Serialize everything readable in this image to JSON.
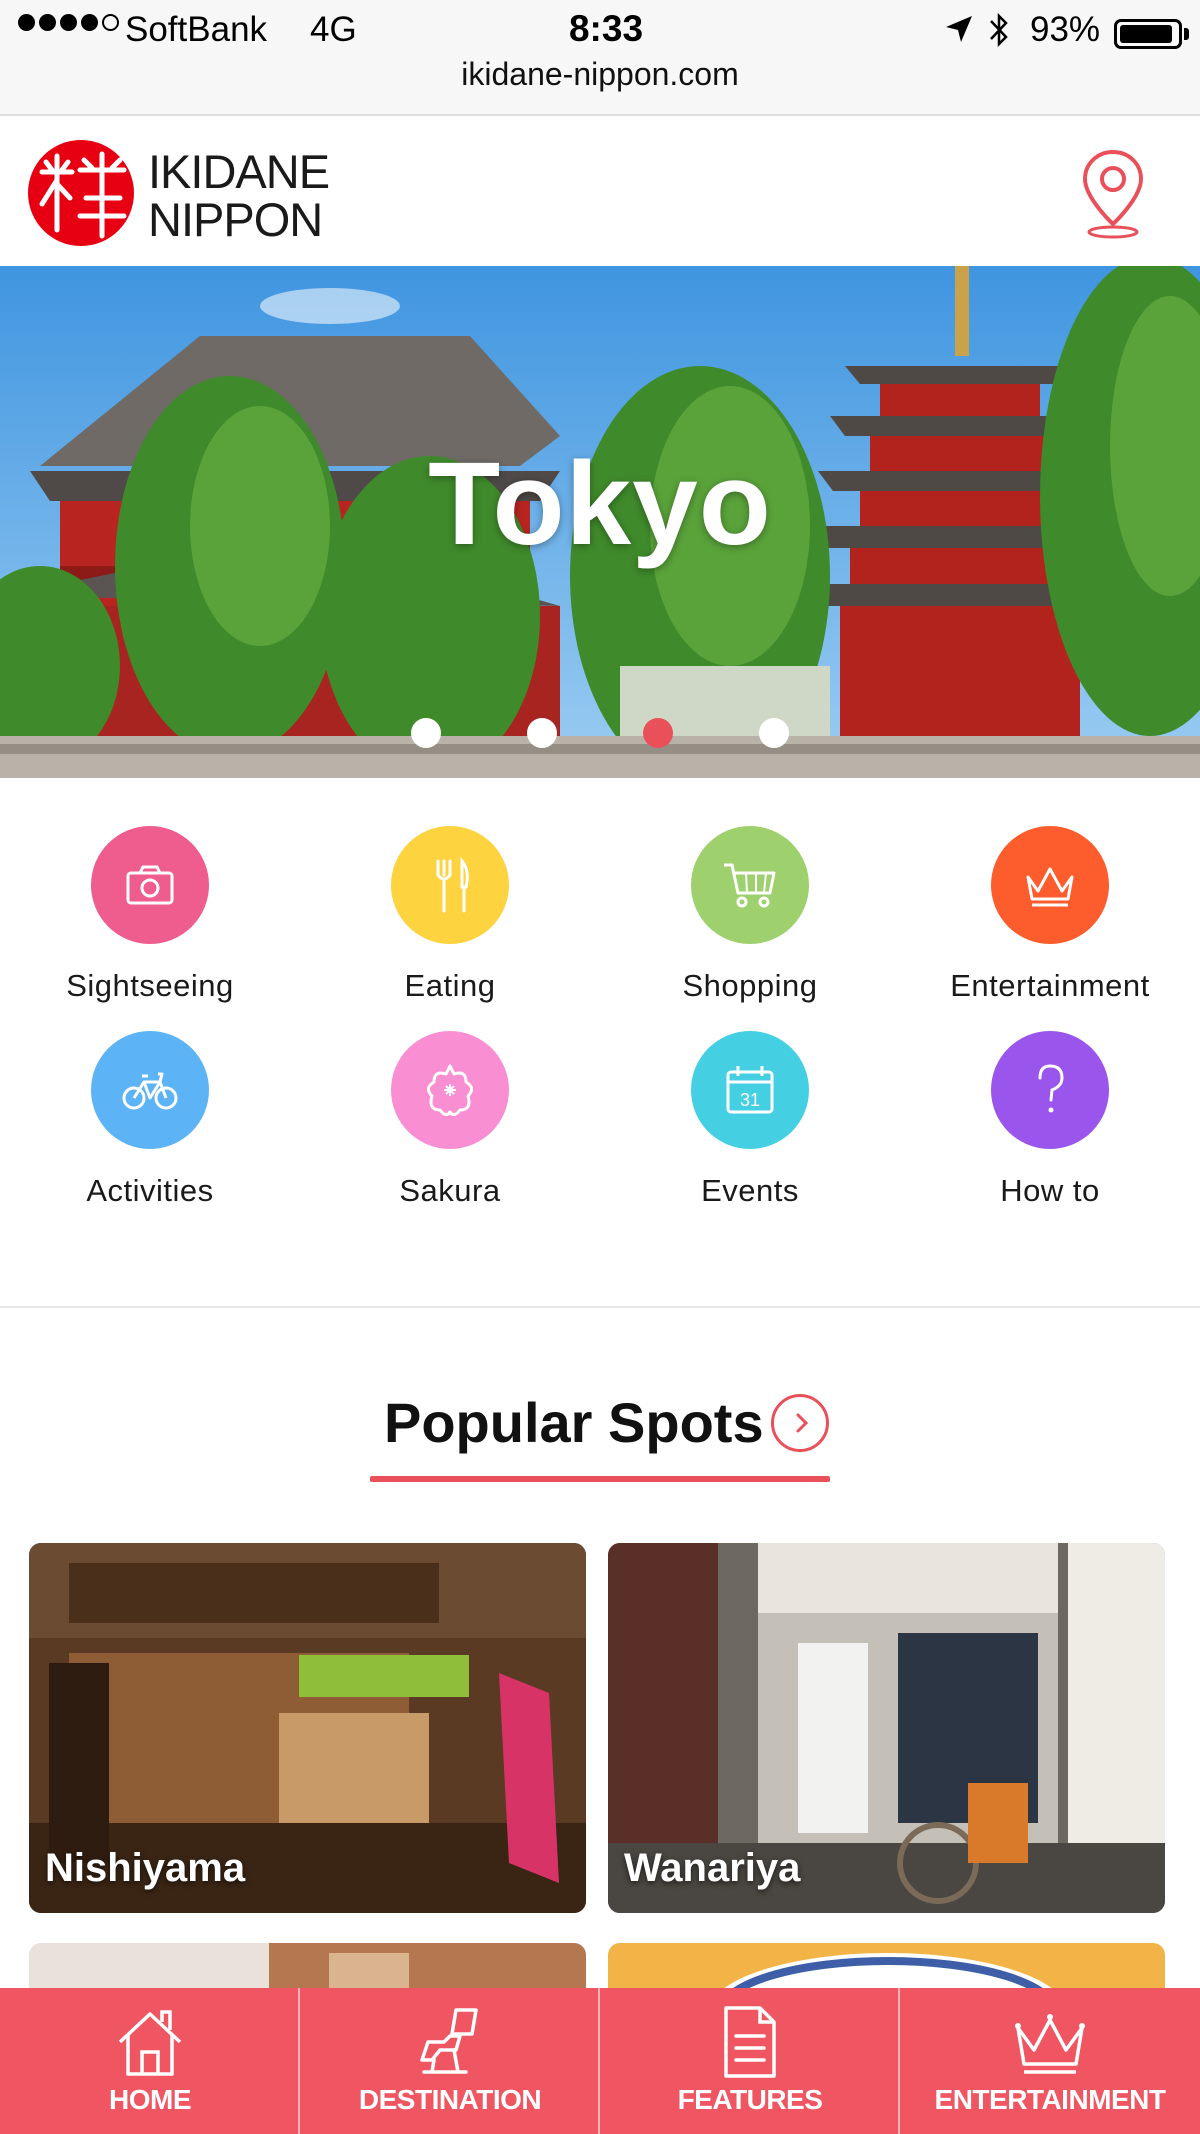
{
  "status_bar": {
    "carrier": "SoftBank",
    "network": "4G",
    "time": "8:33",
    "battery_percent": "93%",
    "battery_level": 0.93,
    "signal_bars": 4,
    "signal_max": 5,
    "url": "ikidane-nippon.com"
  },
  "header": {
    "logo_line1": "IKIDANE",
    "logo_line2": "NIPPON",
    "logo_glyph": "粋",
    "map_icon": "map-pin-icon"
  },
  "hero": {
    "title": "Tokyo",
    "slide_count": 4,
    "active_slide": 3
  },
  "categories": [
    {
      "label": "Sightseeing",
      "icon": "camera-icon",
      "color": "#ef5c8e"
    },
    {
      "label": "Eating",
      "icon": "fork-knife-icon",
      "color": "#fdd33f"
    },
    {
      "label": "Shopping",
      "icon": "cart-icon",
      "color": "#9ed06d"
    },
    {
      "label": "Entertainment",
      "icon": "crown-icon",
      "color": "#fd5d2c"
    },
    {
      "label": "Activities",
      "icon": "bicycle-icon",
      "color": "#5cb3f5"
    },
    {
      "label": "Sakura",
      "icon": "sakura-icon",
      "color": "#f98fd2"
    },
    {
      "label": "Events",
      "icon": "calendar-icon",
      "color": "#45cfe3"
    },
    {
      "label": "How to",
      "icon": "question-icon",
      "color": "#9a55ec"
    }
  ],
  "popular": {
    "title": "Popular Spots",
    "spots": [
      {
        "name": "Nishiyama"
      },
      {
        "name": "Wanariya"
      }
    ]
  },
  "tabbar": {
    "tabs": [
      {
        "label": "HOME",
        "icon": "home-icon"
      },
      {
        "label": "DESTINATION",
        "icon": "destination-icon"
      },
      {
        "label": "FEATURES",
        "icon": "document-icon"
      },
      {
        "label": "ENTERTAINMENT",
        "icon": "crown-icon"
      }
    ]
  },
  "colors": {
    "accent": "#e9505a",
    "tabbar": "#f05662"
  }
}
